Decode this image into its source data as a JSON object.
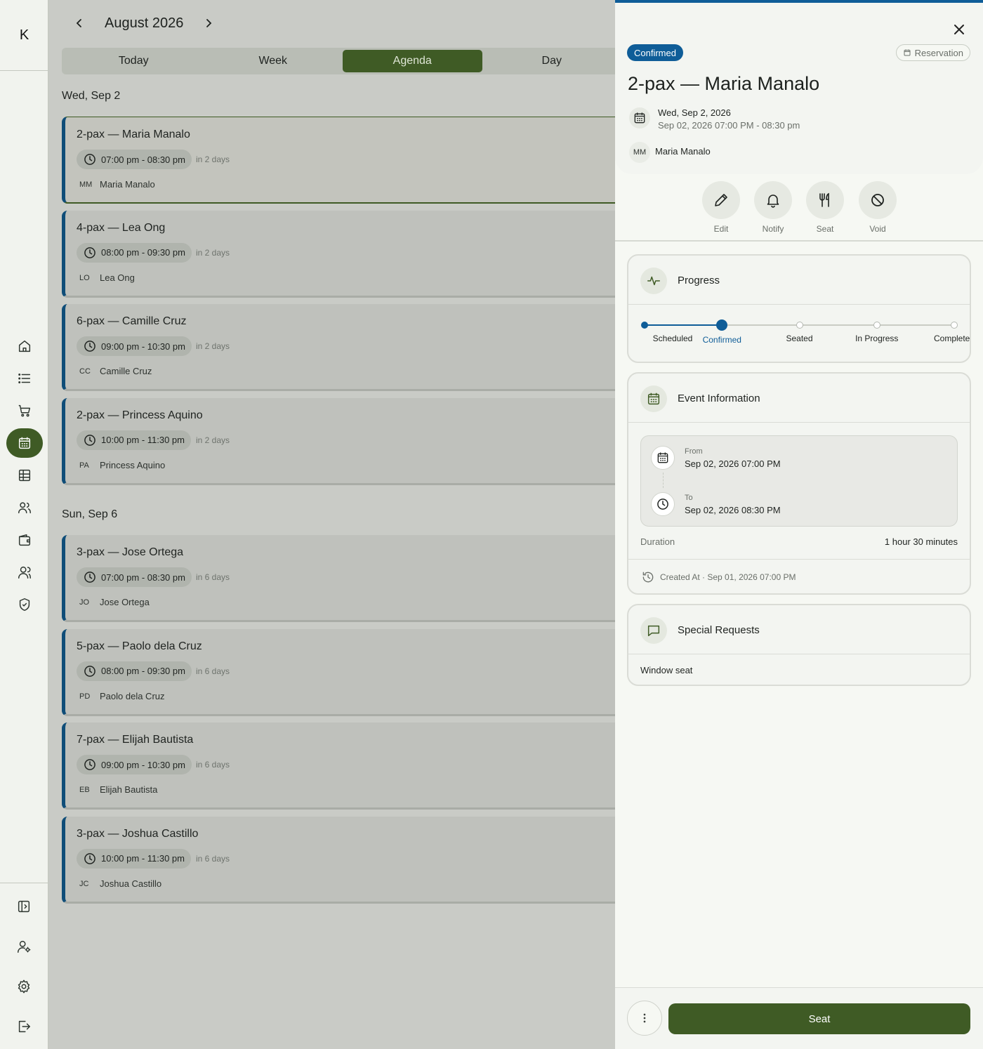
{
  "app": {
    "logo_letter": "K"
  },
  "sidebar": {
    "nav": [
      {
        "icon": "home-icon",
        "active": false
      },
      {
        "icon": "list-icon",
        "active": false
      },
      {
        "icon": "cart-icon",
        "active": false
      },
      {
        "icon": "calendar-icon",
        "active": true
      },
      {
        "icon": "table-icon",
        "active": false
      },
      {
        "icon": "users-icon",
        "active": false
      },
      {
        "icon": "wallet-icon",
        "active": false
      },
      {
        "icon": "team-icon",
        "active": false
      },
      {
        "icon": "shield-icon",
        "active": false
      }
    ],
    "bottom": [
      "expand-panel-icon",
      "user-settings-icon",
      "gear-icon",
      "logout-icon"
    ]
  },
  "calendar": {
    "month_title": "August 2026",
    "tabs": [
      {
        "label": "Today",
        "active": false
      },
      {
        "label": "Week",
        "active": false
      },
      {
        "label": "Agenda",
        "active": true
      },
      {
        "label": "Day",
        "active": false
      }
    ],
    "groups": [
      {
        "date": "Wed, Sep 2",
        "items": [
          {
            "title": "2-pax — Maria Manalo",
            "time": "07:00 pm - 08:30 pm",
            "relative": "in 2 days",
            "initials": "MM",
            "guest": "Maria Manalo",
            "selected": true
          },
          {
            "title": "4-pax — Lea Ong",
            "time": "08:00 pm - 09:30 pm",
            "relative": "in 2 days",
            "initials": "LO",
            "guest": "Lea Ong",
            "selected": false
          },
          {
            "title": "6-pax — Camille Cruz",
            "time": "09:00 pm - 10:30 pm",
            "relative": "in 2 days",
            "initials": "CC",
            "guest": "Camille Cruz",
            "selected": false
          },
          {
            "title": "2-pax — Princess Aquino",
            "time": "10:00 pm - 11:30 pm",
            "relative": "in 2 days",
            "initials": "PA",
            "guest": "Princess Aquino",
            "selected": false
          }
        ]
      },
      {
        "date": "Sun, Sep 6",
        "items": [
          {
            "title": "3-pax — Jose Ortega",
            "time": "07:00 pm - 08:30 pm",
            "relative": "in 6 days",
            "initials": "JO",
            "guest": "Jose Ortega",
            "selected": false
          },
          {
            "title": "5-pax — Paolo dela Cruz",
            "time": "08:00 pm - 09:30 pm",
            "relative": "in 6 days",
            "initials": "PD",
            "guest": "Paolo dela Cruz",
            "selected": false
          },
          {
            "title": "7-pax — Elijah Bautista",
            "time": "09:00 pm - 10:30 pm",
            "relative": "in 6 days",
            "initials": "EB",
            "guest": "Elijah Bautista",
            "selected": false
          },
          {
            "title": "3-pax — Joshua Castillo",
            "time": "10:00 pm - 11:30 pm",
            "relative": "in 6 days",
            "initials": "JC",
            "guest": "Joshua Castillo",
            "selected": false
          }
        ]
      }
    ]
  },
  "detail": {
    "status_badge": "Confirmed",
    "type_badge": "Reservation",
    "title": "2-pax — Maria Manalo",
    "date": "Wed, Sep 2, 2026",
    "range": "Sep 02, 2026 07:00 PM - 08:30 pm",
    "initials": "MM",
    "guest": "Maria Manalo",
    "actions": [
      {
        "label": "Edit",
        "icon": "pencil-icon"
      },
      {
        "label": "Notify",
        "icon": "bell-icon"
      },
      {
        "label": "Seat",
        "icon": "utensils-icon"
      },
      {
        "label": "Void",
        "icon": "ban-icon"
      }
    ],
    "progress": {
      "title": "Progress",
      "steps": [
        "Scheduled",
        "Confirmed",
        "Seated",
        "In Progress",
        "Completed"
      ],
      "current_index": 1
    },
    "event": {
      "title": "Event Information",
      "from_label": "From",
      "from_value": "Sep 02, 2026 07:00 PM",
      "to_label": "To",
      "to_value": "Sep 02, 2026 08:30 PM",
      "duration_label": "Duration",
      "duration_value": "1 hour 30 minutes",
      "created": "Created At · Sep 01, 2026 07:00 PM"
    },
    "requests": {
      "title": "Special Requests",
      "text": "Window seat"
    },
    "footer": {
      "primary_label": "Seat"
    }
  },
  "colors": {
    "brand_green": "#3f5b25",
    "accent_blue": "#0f5d98"
  }
}
